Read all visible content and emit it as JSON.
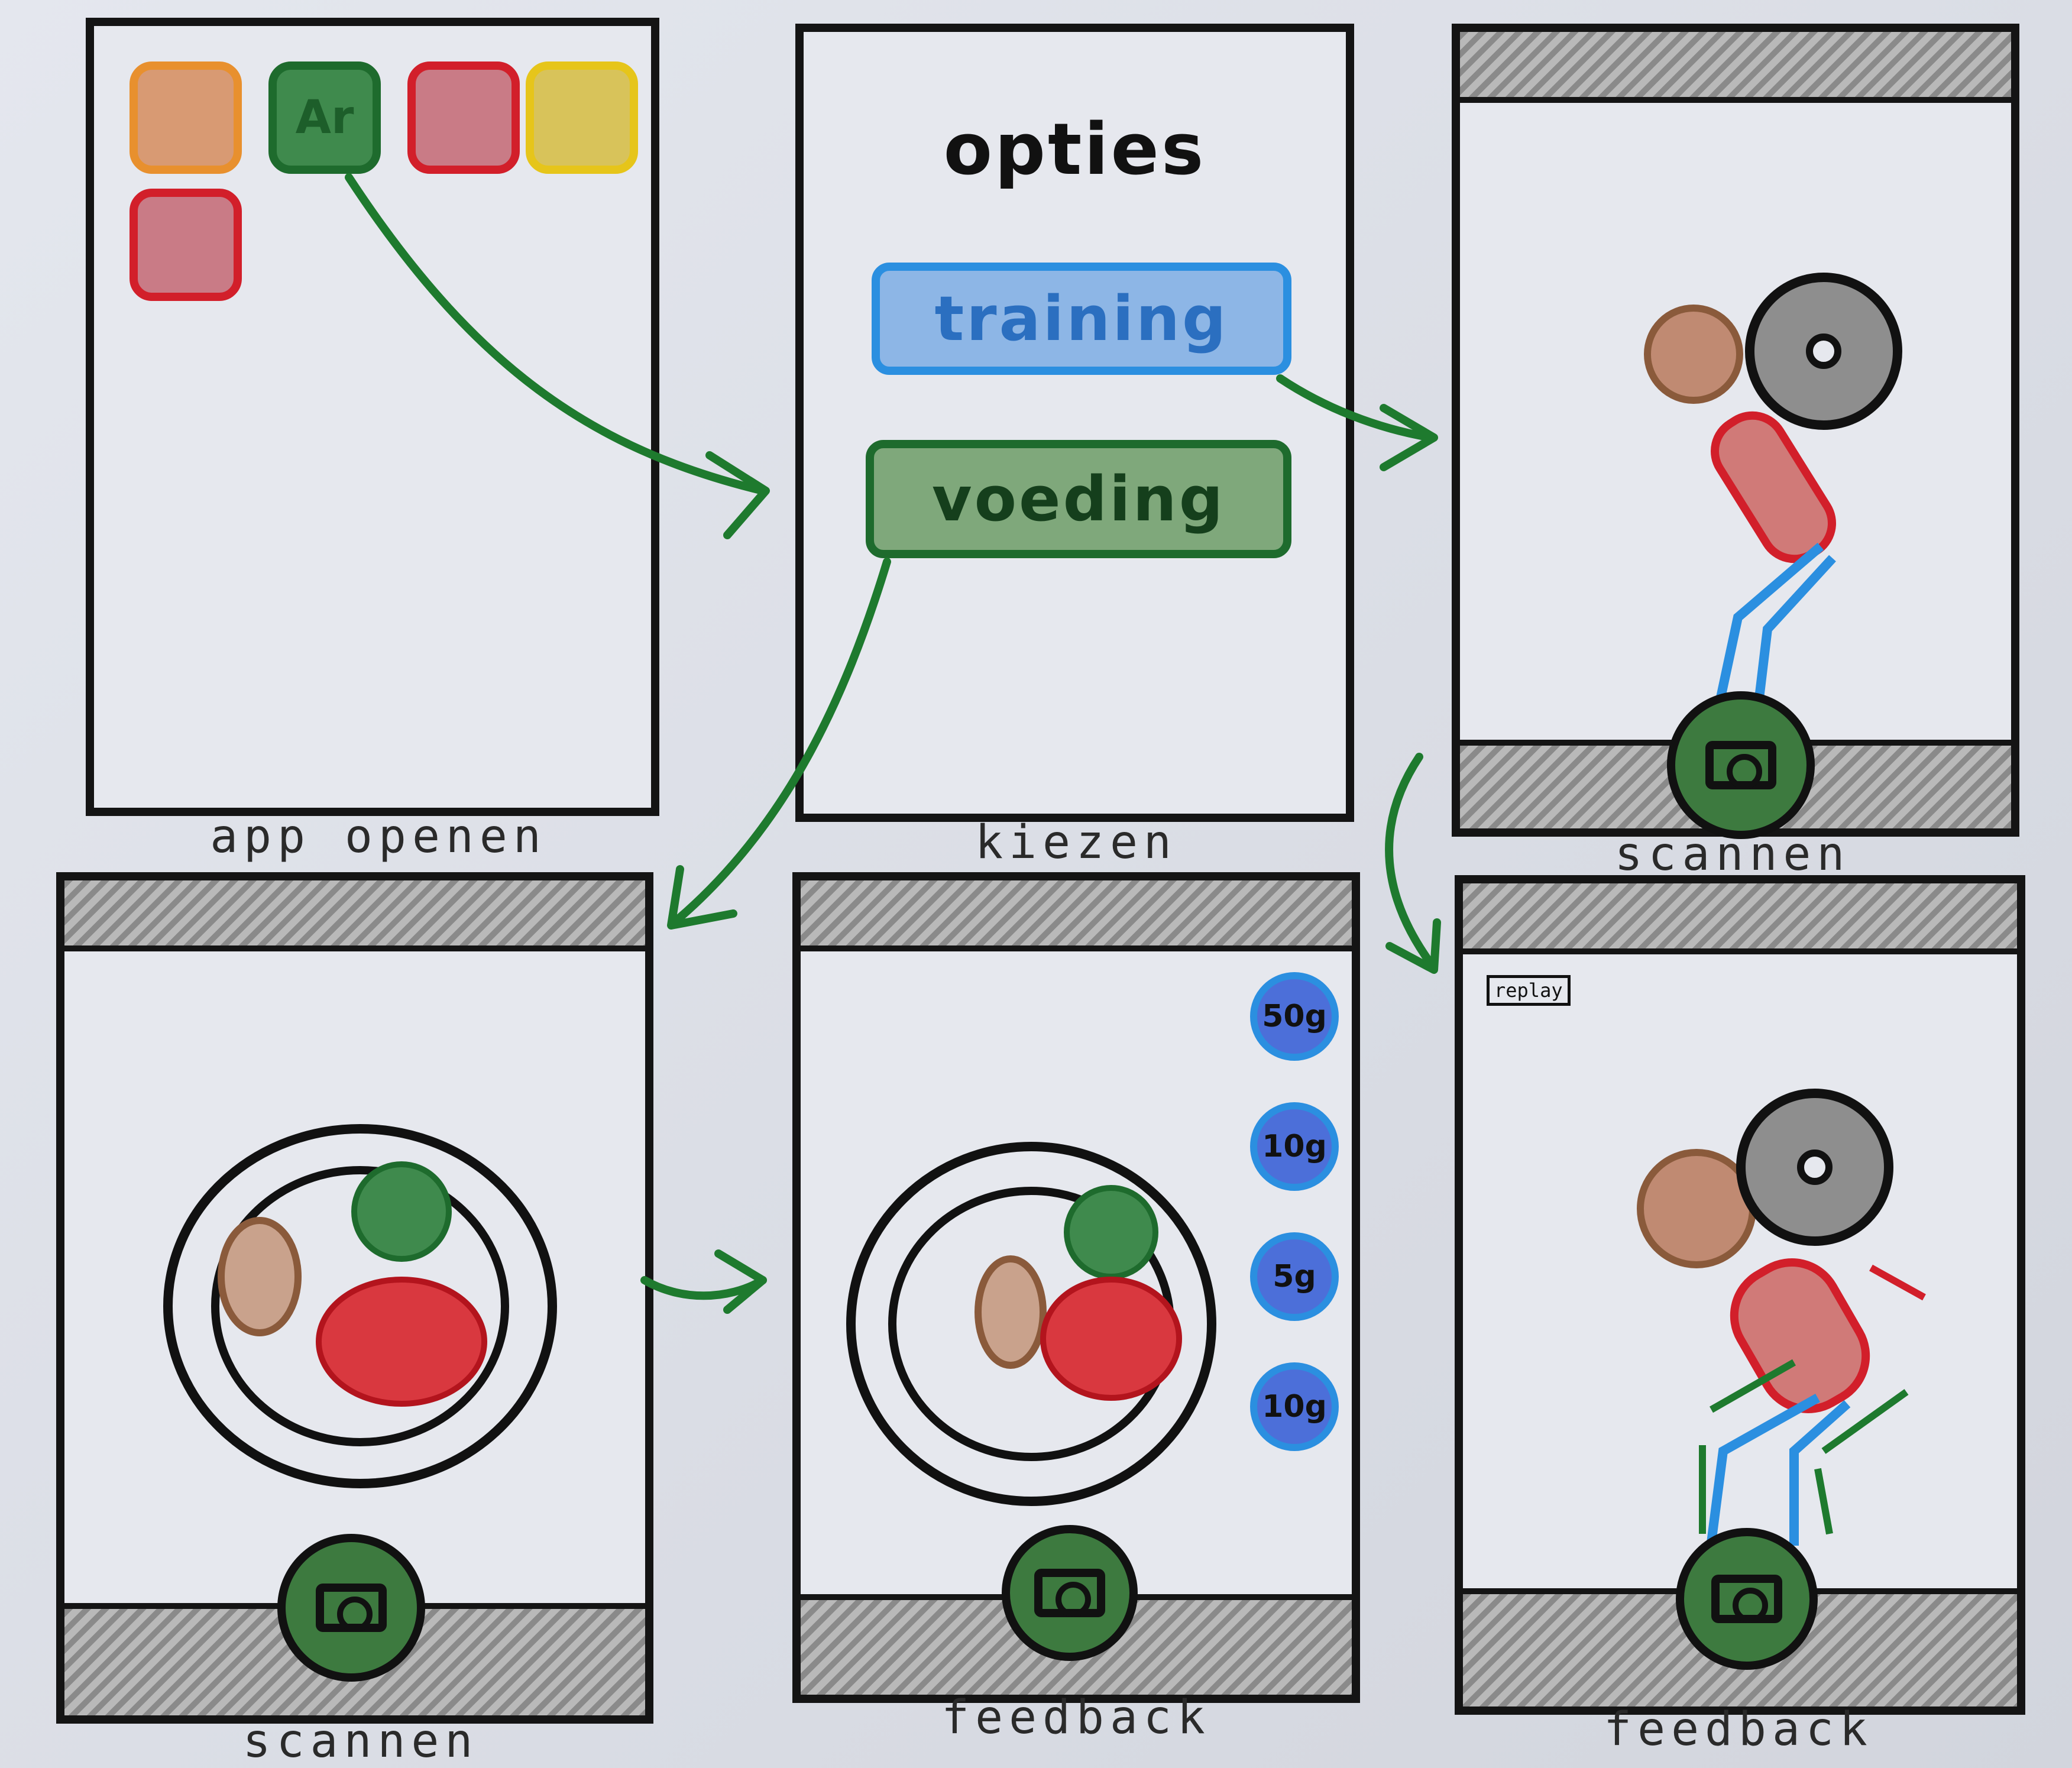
{
  "captions": {
    "p1": "app openen",
    "p2": "kiezen",
    "p3": "scannen",
    "p4": "scannen",
    "p5": "feedback",
    "p6": "feedback"
  },
  "screen1": {
    "app_icons": [
      {
        "label": "",
        "color": "#e8902e"
      },
      {
        "label": "Ar",
        "color": "#1e6b2d"
      },
      {
        "label": "",
        "color": "#d21f2a"
      },
      {
        "label": "",
        "color": "#e6c51a"
      },
      {
        "label": "",
        "color": "#d21f2a"
      }
    ]
  },
  "screen2": {
    "title": "opties",
    "buttons": [
      {
        "label": "training",
        "color": "#2b8fe0"
      },
      {
        "label": "voeding",
        "color": "#1e6b2d"
      }
    ]
  },
  "screen5": {
    "portions": [
      "50g",
      "10g",
      "5g",
      "10g"
    ]
  },
  "screen6": {
    "replay_label": "replay"
  },
  "icons": {
    "shutter": "camera-icon",
    "arrow": "flow-arrow-icon"
  },
  "colors": {
    "frame": "#141414",
    "arrow": "#1e7a2e",
    "blue": "#2b8fe0",
    "green": "#1e6b2d",
    "red": "#d21f2a",
    "brown": "#8a5a3b"
  }
}
